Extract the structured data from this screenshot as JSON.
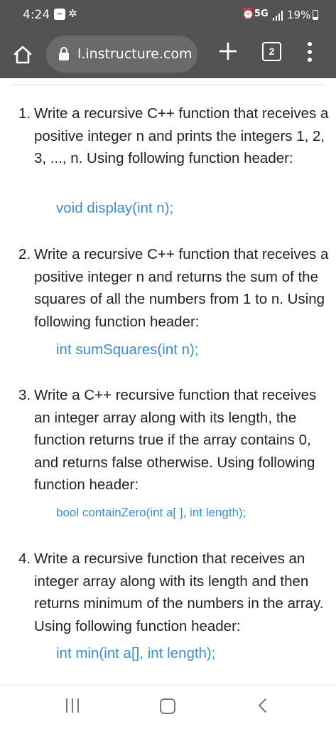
{
  "status": {
    "time": "4:24",
    "network": "5G",
    "battery": "19%"
  },
  "toolbar": {
    "url": "l.instructure.com",
    "tab_count": "2"
  },
  "questions": [
    {
      "number": "1.",
      "text": "Write a recursive C++ function that receives a positive integer n and prints the integers 1, 2, 3, ..., n. Using following function header:",
      "code": "void display(int n);"
    },
    {
      "number": "2.",
      "text": "Write a recursive C++ function that receives a positive integer n and returns the sum of the squares of all the numbers from 1 to n. Using following function header:",
      "code": "int sumSquares(int n);"
    },
    {
      "number": "3.",
      "text": "Write a C++ recursive function that receives an integer array along with its length, the function returns true if the array contains 0, and returns false otherwise. Using following function header:",
      "code": "bool containZero(int a[ ], int length);"
    },
    {
      "number": "4.",
      "text": "Write a recursive function that receives an integer array along with its length and then returns minimum of the numbers in the array. Using following function header:",
      "code": "int min(int a[], int length);"
    }
  ]
}
